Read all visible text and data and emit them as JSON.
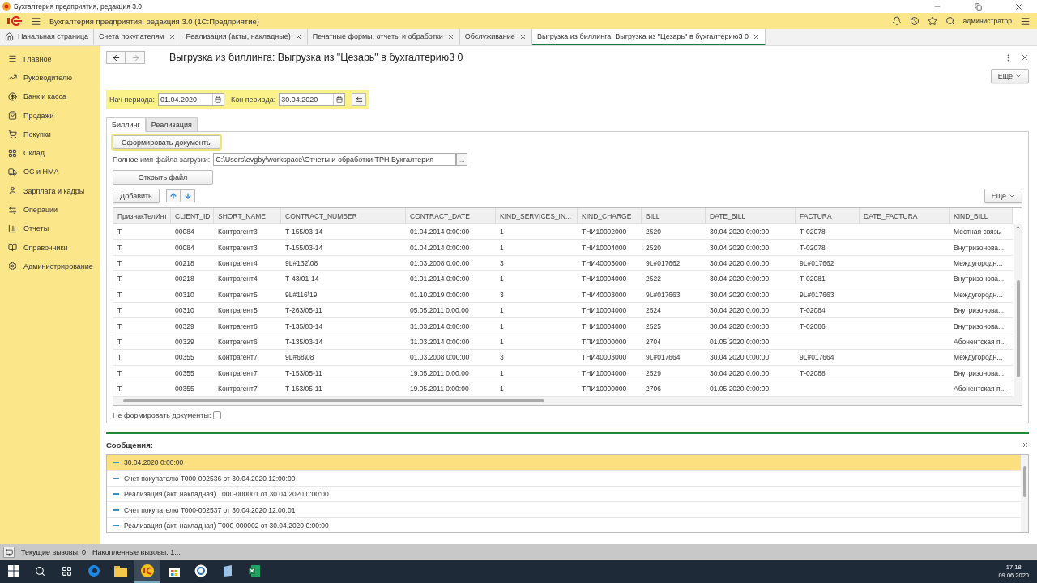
{
  "window": {
    "title": "Бухгалтерия предприятия, редакция 3.0"
  },
  "app_bar": {
    "title": "Бухгалтерия предприятия, редакция 3.0  (1С:Предприятие)",
    "user": "администратор"
  },
  "open_tabs": [
    {
      "label": "Начальная страница",
      "kind": "home",
      "selected": false
    },
    {
      "label": "Счета покупателям",
      "kind": "doc",
      "selected": false
    },
    {
      "label": "Реализация (акты, накладные)",
      "kind": "doc",
      "selected": false
    },
    {
      "label": "Печатные формы, отчеты и обработки",
      "kind": "doc",
      "selected": false
    },
    {
      "label": "Обслуживание",
      "kind": "doc",
      "selected": false
    },
    {
      "label": "Выгрузка из биллинга: Выгрузка из \"Цезарь\" в бухгалтерию3 0",
      "kind": "doc",
      "selected": true
    }
  ],
  "sidebar": {
    "items": [
      "Главное",
      "Руководителю",
      "Банк и касса",
      "Продажи",
      "Покупки",
      "Склад",
      "ОС и НМА",
      "Зарплата и кадры",
      "Операции",
      "Отчеты",
      "Справочники",
      "Администрирование"
    ]
  },
  "form": {
    "title": "Выгрузка из биллинга: Выгрузка из \"Цезарь\" в бухгалтерию3 0",
    "more_button": "Еще"
  },
  "period": {
    "start_label": "Нач периода:",
    "start_value": "01.04.2020",
    "end_label": "Кон периода:",
    "end_value": "30.04.2020"
  },
  "inner_tabs": [
    {
      "label": "Биллинг",
      "selected": true
    },
    {
      "label": "Реализация",
      "selected": false
    }
  ],
  "generate_button": "Сформировать документы",
  "file": {
    "label": "Полное имя файла загрузки:",
    "value": "C:\\Users\\evgby\\workspace\\Отчеты и обработки ТРН Бухгалтерия",
    "browse": "..."
  },
  "open_file_button": "Открыть файл",
  "table": {
    "add_button": "Добавить",
    "more_button": "Еще",
    "columns": [
      "ПризнакТелИнт",
      "CLIENT_ID",
      "SHORT_NAME",
      "CONTRACT_NUMBER",
      "CONTRACT_DATE",
      "KIND_SERVICES_IN...",
      "KIND_CHARGE",
      "BILL",
      "DATE_BILL",
      "FACTURA",
      "DATE_FACTURA",
      "KIND_BILL"
    ],
    "rows": [
      [
        "Т",
        "00084",
        "Контрагент3",
        "Т-155/03-14",
        "01.04.2014 0:00:00",
        "1",
        "ТНИ10002000",
        "2520",
        "30.04.2020 0:00:00",
        "Т-02078",
        null,
        "Местная связь"
      ],
      [
        "Т",
        "00084",
        "Контрагент3",
        "Т-155/03-14",
        "01.04.2014 0:00:00",
        "1",
        "ТНИ10004000",
        "2520",
        "30.04.2020 0:00:00",
        "Т-02078",
        null,
        "Внутризонова..."
      ],
      [
        "Т",
        "00218",
        "Контрагент4",
        "9L#132\\08",
        "01.03.2008 0:00:00",
        "3",
        "ТНИ40003000",
        "9L#017662",
        "30.04.2020 0:00:00",
        "9L#017662",
        null,
        "Междугородн..."
      ],
      [
        "Т",
        "00218",
        "Контрагент4",
        "Т-43/01-14",
        "01.01.2014 0:00:00",
        "1",
        "ТНИ10004000",
        "2522",
        "30.04.2020 0:00:00",
        "Т-02081",
        null,
        "Внутризонова..."
      ],
      [
        "Т",
        "00310",
        "Контрагент5",
        "9L#116\\19",
        "01.10.2019 0:00:00",
        "3",
        "ТНИ40003000",
        "9L#017663",
        "30.04.2020 0:00:00",
        "9L#017663",
        null,
        "Междугородн..."
      ],
      [
        "Т",
        "00310",
        "Контрагент5",
        "Т-263/05-11",
        "05.05.2011 0:00:00",
        "1",
        "ТНИ10004000",
        "2524",
        "30.04.2020 0:00:00",
        "Т-02084",
        null,
        "Внутризонова..."
      ],
      [
        "Т",
        "00329",
        "Контрагент6",
        "Т-135/03-14",
        "31.03.2014 0:00:00",
        "1",
        "ТНИ10004000",
        "2525",
        "30.04.2020 0:00:00",
        "Т-02086",
        null,
        "Внутризонова..."
      ],
      [
        "Т",
        "00329",
        "Контрагент6",
        "Т-135/03-14",
        "31.03.2014 0:00:00",
        "1",
        "ТПИ10000000",
        "2704",
        "01.05.2020 0:00:00",
        null,
        null,
        "Абонентская п..."
      ],
      [
        "Т",
        "00355",
        "Контрагент7",
        "9L#68\\08",
        "01.03.2008 0:00:00",
        "3",
        "ТНИ40003000",
        "9L#017664",
        "30.04.2020 0:00:00",
        "9L#017664",
        null,
        "Междугородн..."
      ],
      [
        "Т",
        "00355",
        "Контрагент7",
        "Т-153/05-11",
        "19.05.2011 0:00:00",
        "1",
        "ТНИ10004000",
        "2529",
        "30.04.2020 0:00:00",
        "Т-02088",
        null,
        "Внутризонова..."
      ],
      [
        "Т",
        "00355",
        "Контрагент7",
        "Т-153/05-11",
        "19.05.2011 0:00:00",
        "1",
        "ТПИ10000000",
        "2706",
        "01.05.2020 0:00:00",
        null,
        null,
        "Абонентская п..."
      ]
    ]
  },
  "no_docs": {
    "label": "Не формировать документы:",
    "checked": false
  },
  "messages": {
    "title": "Сообщения:",
    "items": [
      {
        "text": "30.04.2020 0:00:00",
        "selected": true
      },
      {
        "text": "Счет покупателю Т000-002536 от 30.04.2020 12:00:00",
        "selected": false
      },
      {
        "text": "Реализация (акт, накладная) Т000-000001 от 30.04.2020 0:00:00",
        "selected": false
      },
      {
        "text": "Счет покупателю Т000-002537 от 30.04.2020 12:00:01",
        "selected": false
      },
      {
        "text": "Реализация (акт, накладная) Т000-000002 от 30.04.2020 0:00:00",
        "selected": false
      }
    ]
  },
  "status_bar": {
    "current": "Текущие вызовы: 0",
    "accumulated": "Накопленные вызовы: 1..."
  },
  "taskbar": {
    "time": "17:18",
    "date": "09.06.2020",
    "apps": [
      {
        "kind": "edge",
        "selected": false
      },
      {
        "kind": "folder",
        "selected": false
      },
      {
        "kind": "onec",
        "selected": true
      },
      {
        "kind": "store",
        "selected": false
      },
      {
        "kind": "disc",
        "selected": false
      },
      {
        "kind": "note",
        "selected": false
      },
      {
        "kind": "excel",
        "selected": false
      }
    ]
  }
}
